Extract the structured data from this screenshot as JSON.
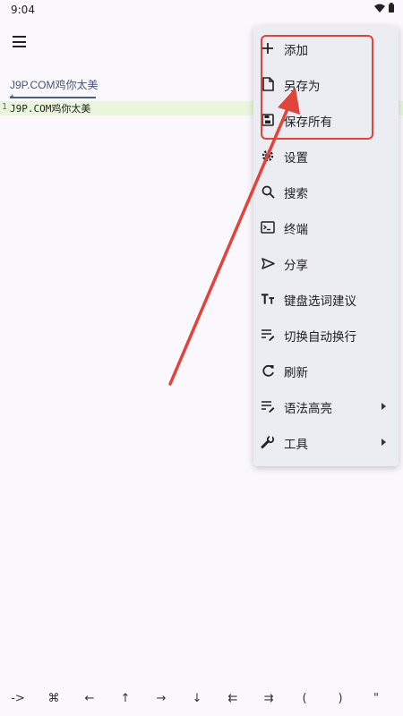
{
  "status": {
    "time": "9:04",
    "wifi_icon": "wifi-icon",
    "battery_icon": "battery-icon"
  },
  "toolbar": {
    "menu_icon": "hamburger-menu-icon"
  },
  "tab": {
    "title": "J9P.COM鸡你太美*"
  },
  "editor": {
    "lines": [
      {
        "number": "1",
        "text": "J9P.COM鸡你太美"
      }
    ],
    "current_line_color": "#e9f6dc"
  },
  "menu": {
    "items": [
      {
        "label": "添加",
        "icon": "plus-icon",
        "submenu": false
      },
      {
        "label": "另存为",
        "icon": "file-icon",
        "submenu": false
      },
      {
        "label": "保存所有",
        "icon": "save-icon",
        "submenu": false
      },
      {
        "label": "设置",
        "icon": "gear-icon",
        "submenu": false
      },
      {
        "label": "搜索",
        "icon": "search-icon",
        "submenu": false
      },
      {
        "label": "终端",
        "icon": "terminal-icon",
        "submenu": false
      },
      {
        "label": "分享",
        "icon": "share-icon",
        "submenu": false
      },
      {
        "label": "键盘选词建议",
        "icon": "text-size-icon",
        "submenu": false
      },
      {
        "label": "切换自动换行",
        "icon": "wrap-text-icon",
        "submenu": false
      },
      {
        "label": "刷新",
        "icon": "refresh-icon",
        "submenu": false
      },
      {
        "label": "语法高亮",
        "icon": "syntax-highlight-icon",
        "submenu": true
      },
      {
        "label": "工具",
        "icon": "wrench-icon",
        "submenu": true
      }
    ]
  },
  "annotation": {
    "color": "#e0443a"
  },
  "keybar": {
    "keys": [
      "->",
      "⌘",
      "←",
      "↑",
      "→",
      "↓",
      "⇇",
      "⇉",
      "(",
      ")",
      "\""
    ]
  }
}
